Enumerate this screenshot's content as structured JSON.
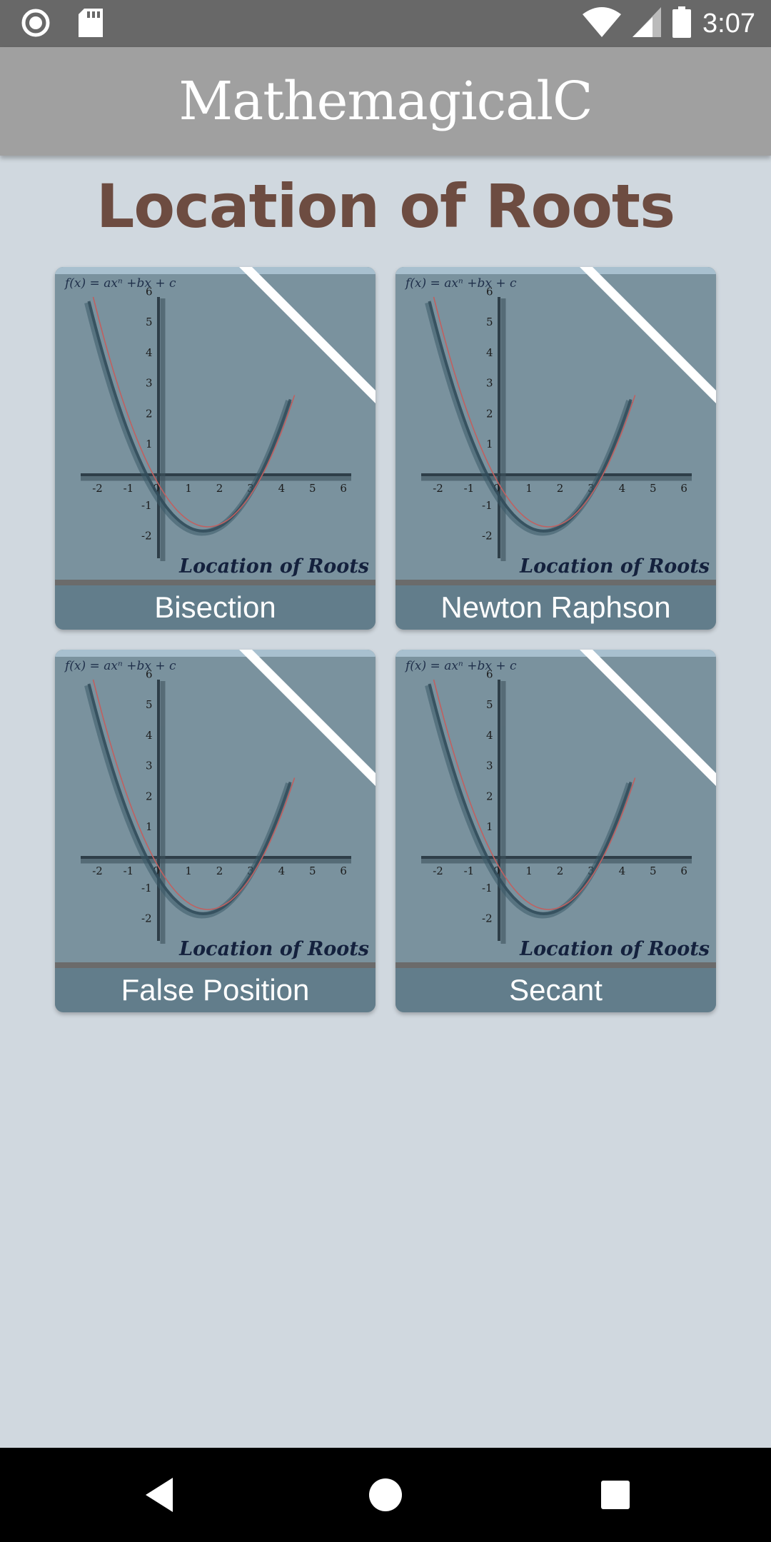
{
  "status_bar": {
    "time": "3:07",
    "icons": [
      "record-icon",
      "sd-card-icon",
      "wifi-icon",
      "signal-icon",
      "battery-icon"
    ]
  },
  "app_bar": {
    "title": "MathemagicalC"
  },
  "page": {
    "title": "Location of Roots"
  },
  "card_image_text": {
    "formula": "f(x) = axⁿ +bx + c",
    "caption": "Location of Roots",
    "x_ticks": [
      "-2",
      "-1",
      "0",
      "1",
      "2",
      "3",
      "4",
      "5",
      "6"
    ],
    "y_ticks": [
      "6",
      "5",
      "4",
      "3",
      "2",
      "1",
      "-1",
      "-2"
    ]
  },
  "cards": [
    {
      "label": "Bisection"
    },
    {
      "label": "Newton Raphson"
    },
    {
      "label": "False Position"
    },
    {
      "label": "Secant"
    }
  ],
  "colors": {
    "background": "#d0d8df",
    "app_bar": "#a0a0a0",
    "title": "#6d4c41",
    "card_image": "#7a929e",
    "card_label": "#627d8b"
  },
  "nav_bar": {
    "icons": [
      "back-icon",
      "home-icon",
      "recent-apps-icon"
    ]
  }
}
